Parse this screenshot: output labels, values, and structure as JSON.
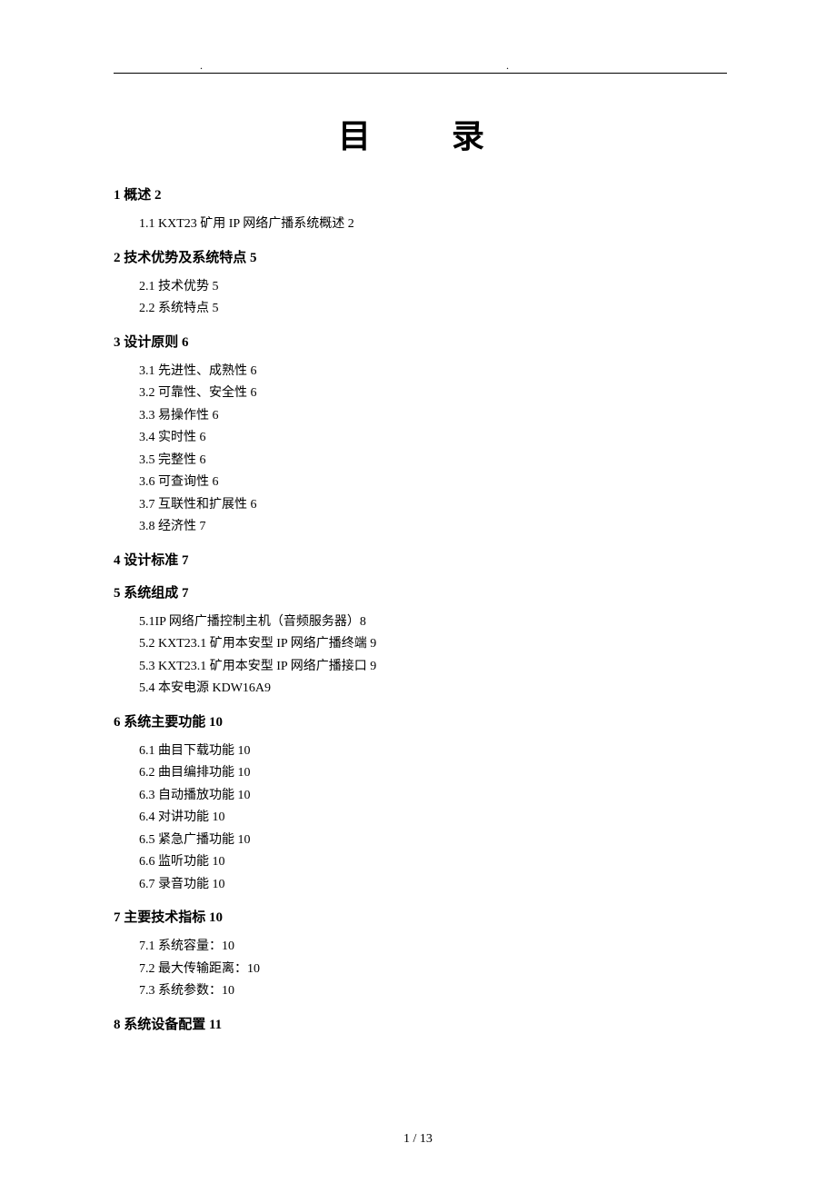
{
  "title": "目 录",
  "sections": [
    {
      "heading": "1 概述 2",
      "items": [
        "1.1 KXT23 矿用 IP 网络广播系统概述 2"
      ]
    },
    {
      "heading": "2 技术优势及系统特点 5",
      "items": [
        "2.1 技术优势 5",
        "2.2 系统特点 5"
      ]
    },
    {
      "heading": "3 设计原则 6",
      "items": [
        "3.1 先进性、成熟性 6",
        "3.2 可靠性、安全性 6",
        "3.3 易操作性 6",
        "3.4 实时性 6",
        "3.5 完整性 6",
        "3.6 可查询性 6",
        "3.7 互联性和扩展性 6",
        "3.8 经济性 7"
      ]
    },
    {
      "heading": "4 设计标准 7",
      "items": []
    },
    {
      "heading": "5 系统组成 7",
      "items": [
        "5.1IP 网络广播控制主机（音频服务器）8",
        "5.2 KXT23.1 矿用本安型 IP 网络广播终端 9",
        "5.3 KXT23.1 矿用本安型 IP 网络广播接口 9",
        "5.4 本安电源 KDW16A9"
      ]
    },
    {
      "heading": "6 系统主要功能 10",
      "items": [
        "6.1 曲目下载功能 10",
        "6.2 曲目编排功能 10",
        "6.3 自动播放功能 10",
        "6.4 对讲功能 10",
        "6.5 紧急广播功能 10",
        "6.6 监听功能 10",
        "6.7 录音功能 10"
      ]
    },
    {
      "heading": "7 主要技术指标 10",
      "items": [
        "7.1 系统容量：10",
        "7.2 最大传输距离：10",
        "7.3 系统参数：10"
      ]
    },
    {
      "heading": "8 系统设备配置 11",
      "items": []
    }
  ],
  "footer": "1 / 13"
}
